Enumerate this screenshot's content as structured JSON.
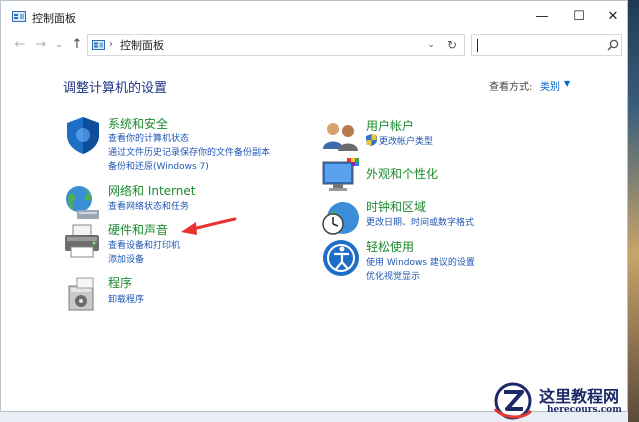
{
  "window": {
    "title": "控制面板",
    "controls": {
      "minimize": "—",
      "maximize": "☐",
      "close": "✕"
    }
  },
  "navbar": {
    "back": "←",
    "forward": "→",
    "recent": "⌄",
    "up": "↑",
    "breadcrumb_sep": "›",
    "address": "控制面板",
    "dropdown": "⌄",
    "refresh": "↻"
  },
  "main": {
    "heading": "调整计算机的设置",
    "view_by_label": "查看方式:",
    "view_by_value": "类别",
    "view_by_caret": "▼"
  },
  "categories_left": [
    {
      "title": "系统和安全",
      "icon": "shield-icon",
      "links": [
        "查看你的计算机状态",
        "通过文件历史记录保存你的文件备份副本",
        "备份和还原(Windows 7)"
      ]
    },
    {
      "title": "网络和 Internet",
      "icon": "network-globe-icon",
      "links": [
        "查看网络状态和任务"
      ]
    },
    {
      "title": "硬件和声音",
      "icon": "printer-icon",
      "links": [
        "查看设备和打印机",
        "添加设备"
      ]
    },
    {
      "title": "程序",
      "icon": "programs-icon",
      "links": [
        "卸载程序"
      ]
    }
  ],
  "categories_right": [
    {
      "title": "用户帐户",
      "icon": "users-icon",
      "links": [
        "更改帐户类型"
      ]
    },
    {
      "title": "外观和个性化",
      "icon": "monitor-icon",
      "links": []
    },
    {
      "title": "时钟和区域",
      "icon": "clock-globe-icon",
      "links": [
        "更改日期、时间或数字格式"
      ]
    },
    {
      "title": "轻松使用",
      "icon": "accessibility-icon",
      "links": [
        "使用 Windows 建议的设置",
        "优化视觉显示"
      ]
    }
  ],
  "watermark": {
    "cn": "这里教程网",
    "en": "herecours.com"
  },
  "colors": {
    "heading": "#1e3287",
    "category_title": "#1c8a2e",
    "link": "#1f57b5",
    "accent": "#0066cc",
    "annotation_arrow": "#e8322e"
  }
}
